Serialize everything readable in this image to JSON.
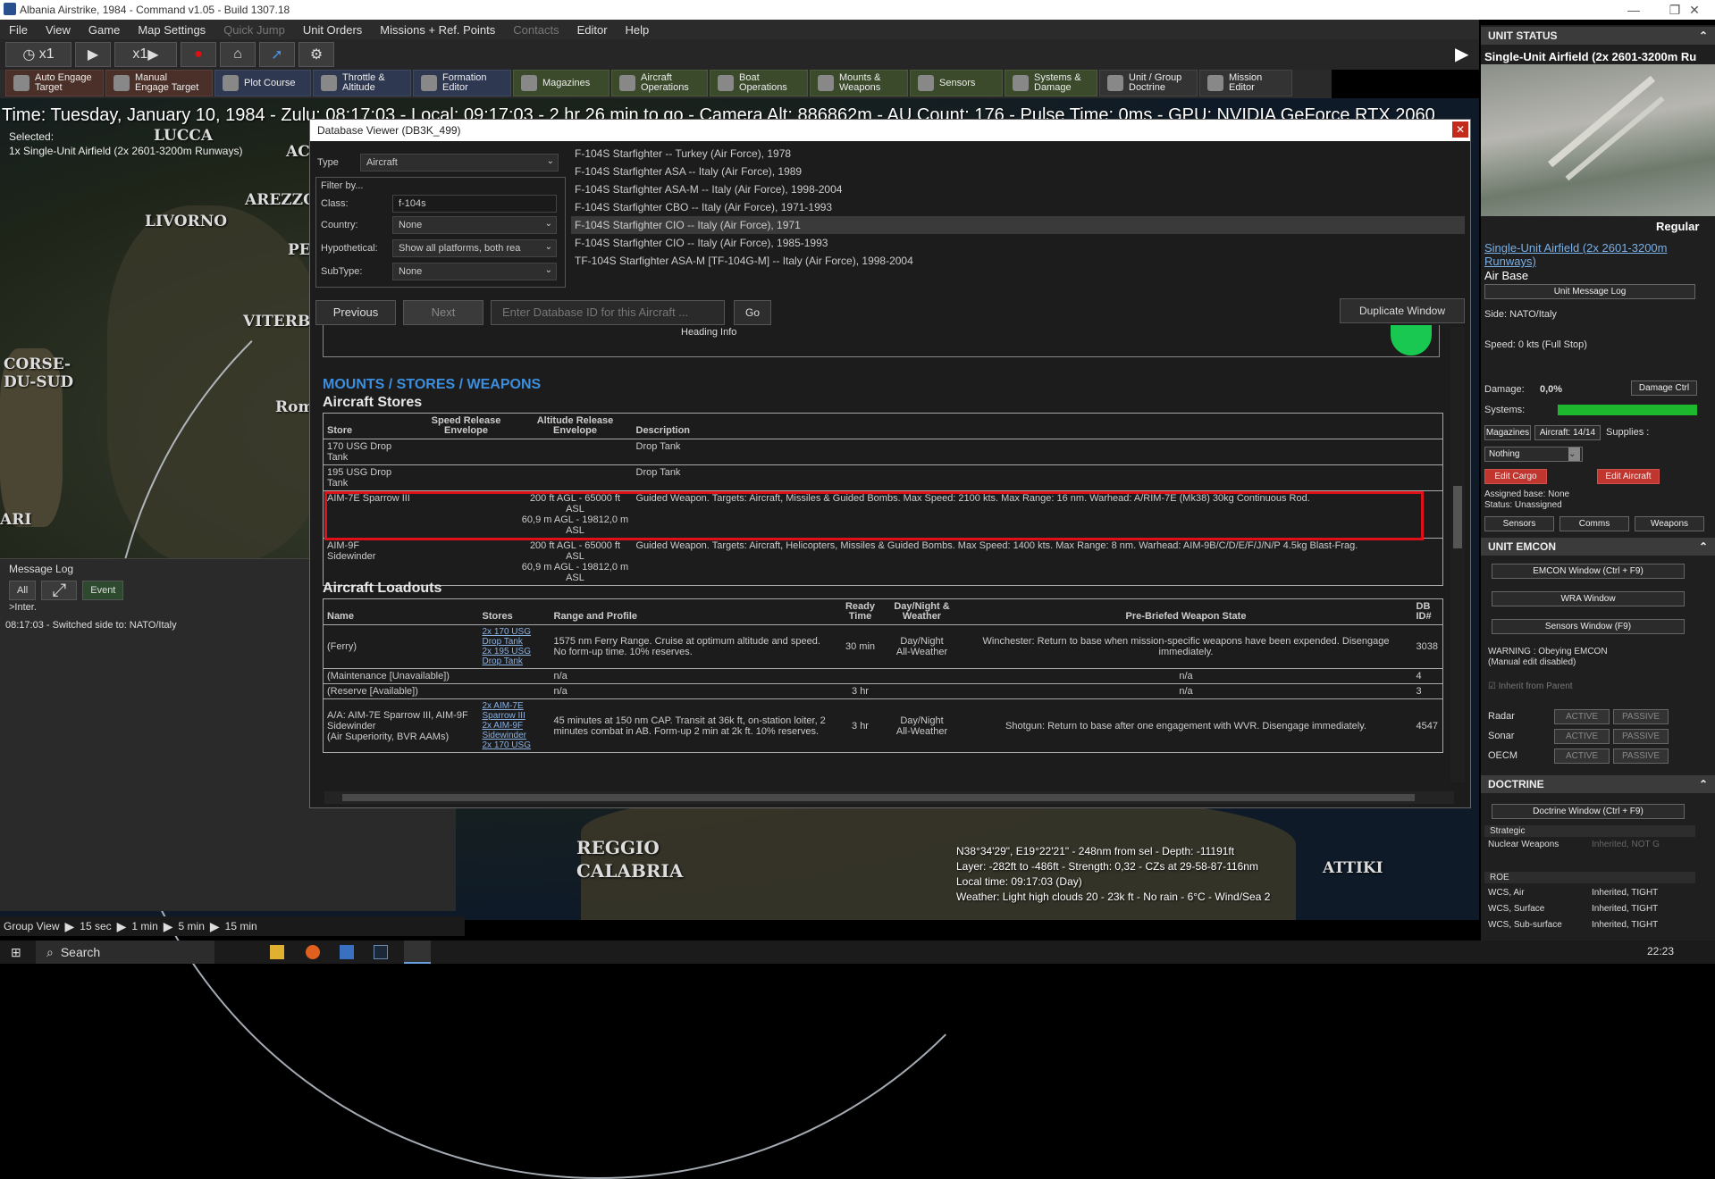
{
  "window_title": "Albania Airstrike, 1984 - Command v1.05 - Build 1307.18",
  "menu": [
    "File",
    "View",
    "Game",
    "Map Settings",
    "Quick Jump",
    "Unit Orders",
    "Missions + Ref. Points",
    "Contacts",
    "Editor",
    "Help"
  ],
  "toolbar1": {
    "speed1": "x1",
    "speed2": "x1"
  },
  "toolbar2": [
    {
      "label": "Auto Engage\nTarget"
    },
    {
      "label": "Manual\nEngage Target"
    },
    {
      "label": "Plot Course"
    },
    {
      "label": "Throttle &\nAltitude"
    },
    {
      "label": "Formation\nEditor"
    },
    {
      "label": "Magazines"
    },
    {
      "label": "Aircraft\nOperations"
    },
    {
      "label": "Boat\nOperations"
    },
    {
      "label": "Mounts &\nWeapons"
    },
    {
      "label": "Sensors"
    },
    {
      "label": "Systems &\nDamage"
    },
    {
      "label": "Unit / Group\nDoctrine"
    },
    {
      "label": "Mission\nEditor"
    }
  ],
  "status_line": "Time: Tuesday, January 10, 1984 - Zulu: 08:17:03 - Local: 09:17:03 - 2 hr 26 min to go - Camera Alt: 886862m - AU Count: 176 - Pulse Time: 0ms - GPU: NVIDIA GeForce RTX 2060",
  "selected": {
    "label": "Selected:",
    "value": "1x Single-Unit Airfield (2x 2601-3200m Runways)"
  },
  "map_labels": [
    "LUCCA",
    "LIVORNO",
    "AREZZO",
    "VITERBO",
    "CORSE-\nDU-SUD",
    "Roma",
    "ARI",
    "REGGIO\nCALABRIA",
    "ATTIKI",
    "AC",
    "PE"
  ],
  "message_log": {
    "title": "Message Log",
    "btn_all": "All",
    "btn_event": "Event",
    "inter": ">Inter.",
    "line": "08:17:03 - Switched side to: NATO/Italy"
  },
  "group_view": {
    "label": "Group View",
    "steps": [
      "15 sec",
      "1 min",
      "5 min",
      "15 min"
    ]
  },
  "db_window": {
    "title": "Database Viewer (DB3K_499)",
    "type_label": "Type",
    "type_value": "Aircraft",
    "filter_label": "Filter by...",
    "class_label": "Class:",
    "class_value": "f-104s",
    "country_label": "Country:",
    "country_value": "None",
    "hypo_label": "Hypothetical:",
    "hypo_value": "Show all platforms, both rea",
    "subtype_label": "SubType:",
    "subtype_value": "None",
    "results": [
      "F-104S Starfighter -- Turkey (Air Force), 1978",
      "F-104S Starfighter ASA -- Italy (Air Force), 1989",
      "F-104S Starfighter ASA-M -- Italy (Air Force), 1998-2004",
      "F-104S Starfighter CBO -- Italy (Air Force), 1971-1993",
      "F-104S Starfighter CIO -- Italy (Air Force), 1971",
      "F-104S Starfighter CIO -- Italy (Air Force), 1985-1993",
      "TF-104S Starfighter ASA-M [TF-104G-M] -- Italy (Air Force), 1998-2004"
    ],
    "btn_previous": "Previous",
    "btn_next": "Next",
    "id_placeholder": "Enter Database ID for this Aircraft ...",
    "btn_go": "Go",
    "btn_duplicate": "Duplicate Window",
    "heading_info": "Heading Info",
    "section": "MOUNTS / STORES / WEAPONS",
    "stores_title": "Aircraft Stores",
    "stores_cols": [
      "Store",
      "Speed Release Envelope",
      "Altitude Release Envelope",
      "Description"
    ],
    "stores": [
      {
        "store": "170 USG Drop Tank",
        "speed": "",
        "alt": "",
        "desc": "Drop Tank"
      },
      {
        "store": "195 USG Drop Tank",
        "speed": "",
        "alt": "",
        "desc": "Drop Tank"
      },
      {
        "store": "AIM-7E Sparrow III",
        "speed": "",
        "alt": "200 ft AGL - 65000 ft ASL\n60,9 m AGL - 19812,0 m ASL",
        "desc": "Guided Weapon. Targets: Aircraft, Missiles & Guided Bombs. Max Speed: 2100 kts. Max Range: 16 nm. Warhead: A/RIM-7E (Mk38) 30kg Continuous Rod."
      },
      {
        "store": "AIM-9F Sidewinder",
        "speed": "",
        "alt": "200 ft AGL - 65000 ft ASL\n60,9 m AGL - 19812,0 m ASL",
        "desc": "Guided Weapon. Targets: Aircraft, Helicopters, Missiles & Guided Bombs. Max Speed: 1400 kts. Max Range: 8 nm. Warhead: AIM-9B/C/D/E/F/J/N/P 4.5kg Blast-Frag."
      }
    ],
    "loadouts_title": "Aircraft Loadouts",
    "loadout_cols": [
      "Name",
      "Stores",
      "Range and Profile",
      "Ready Time",
      "Day/Night & Weather",
      "Pre-Briefed Weapon State",
      "DB ID#"
    ],
    "loadouts": [
      {
        "name": "(Ferry)",
        "stores": "2x 170 USG Drop Tank\n2x 195 USG Drop Tank",
        "range": "1575 nm Ferry Range. Cruise at optimum altitude and speed. No form-up time. 10% reserves.",
        "ready": "30 min",
        "dn": "Day/Night\nAll-Weather",
        "state": "Winchester: Return to base when mission-specific weapons have been expended. Disengage immediately.",
        "id": "3038"
      },
      {
        "name": "(Maintenance [Unavailable])",
        "stores": "",
        "range": "n/a",
        "ready": "",
        "dn": "",
        "state": "n/a",
        "id": "4"
      },
      {
        "name": "(Reserve [Available])",
        "stores": "",
        "range": "n/a",
        "ready": "3 hr",
        "dn": "",
        "state": "n/a",
        "id": "3"
      },
      {
        "name": "A/A: AIM-7E Sparrow III, AIM-9F Sidewinder\n(Air Superiority, BVR AAMs)",
        "stores": "2x AIM-7E Sparrow III\n2x AIM-9F Sidewinder\n2x 170 USG",
        "range": "45 minutes at 150 nm CAP. Transit at 36k ft, on-station loiter, 2 minutes combat in AB. Form-up 2 min at 2k ft. 10% reserves.",
        "ready": "3 hr",
        "dn": "Day/Night\nAll-Weather",
        "state": "Shotgun: Return to base after one engagement with WVR. Disengage immediately.",
        "id": "4547"
      }
    ]
  },
  "coords": {
    "l1": "N38°34'29\", E19°22'21\" - 248nm from sel - Depth: -11191ft",
    "l2": "Layer: -282ft to -486ft - Strength: 0,32 - CZs at 29-58-87-116nm",
    "l3": "Local time: 09:17:03 (Day)",
    "l4": "Weather: Light high clouds 20 - 23k ft - No rain - 6°C - Wind/Sea 2"
  },
  "right_panel": {
    "unit_status": "UNIT STATUS",
    "unit_name": "Single-Unit Airfield (2x 2601-3200m Ru",
    "regular": "Regular",
    "unit_link": "Single-Unit Airfield (2x 2601-3200m Runways)",
    "air_base": "Air Base",
    "msg_log_btn": "Unit Message Log",
    "side": "Side: NATO/Italy",
    "speed": "Speed: 0 kts (Full Stop)",
    "damage_label": "Damage:",
    "damage_value": "0,0%",
    "damage_ctrl": "Damage Ctrl",
    "systems_label": "Systems:",
    "magazines_btn": "Magazines",
    "aircraft_btn": "Aircraft: 14/14",
    "supplies": "Supplies :",
    "nothing": "Nothing",
    "edit_cargo": "Edit Cargo",
    "edit_aircraft": "Edit Aircraft",
    "assigned_base": "Assigned base: None",
    "status": "Status: Unassigned",
    "sensors_btn": "Sensors",
    "comms_btn": "Comms",
    "weapons_btn": "Weapons",
    "emcon": "UNIT EMCON",
    "emcon_window": "EMCON Window (Ctrl + F9)",
    "wra_window": "WRA Window",
    "sensors_window": "Sensors Window (F9)",
    "warning": "WARNING : Obeying EMCON\n(Manual edit disabled)",
    "inherit": "Inherit from Parent",
    "radar": "Radar",
    "sonar": "Sonar",
    "oecm": "OECM",
    "active": "ACTIVE",
    "passive": "PASSIVE",
    "doctrine": "DOCTRINE",
    "doctrine_window": "Doctrine Window (Ctrl + F9)",
    "strategic": "Strategic",
    "nuclear": "Nuclear Weapons",
    "nuclear_val": "Inherited, NOT G",
    "roe": "ROE",
    "wcs_air": "WCS, Air",
    "wcs_surface": "WCS, Surface",
    "wcs_sub": "WCS, Sub-surface",
    "tight": "Inherited, TIGHT"
  },
  "taskbar": {
    "search": "Search",
    "time": "22:23"
  }
}
